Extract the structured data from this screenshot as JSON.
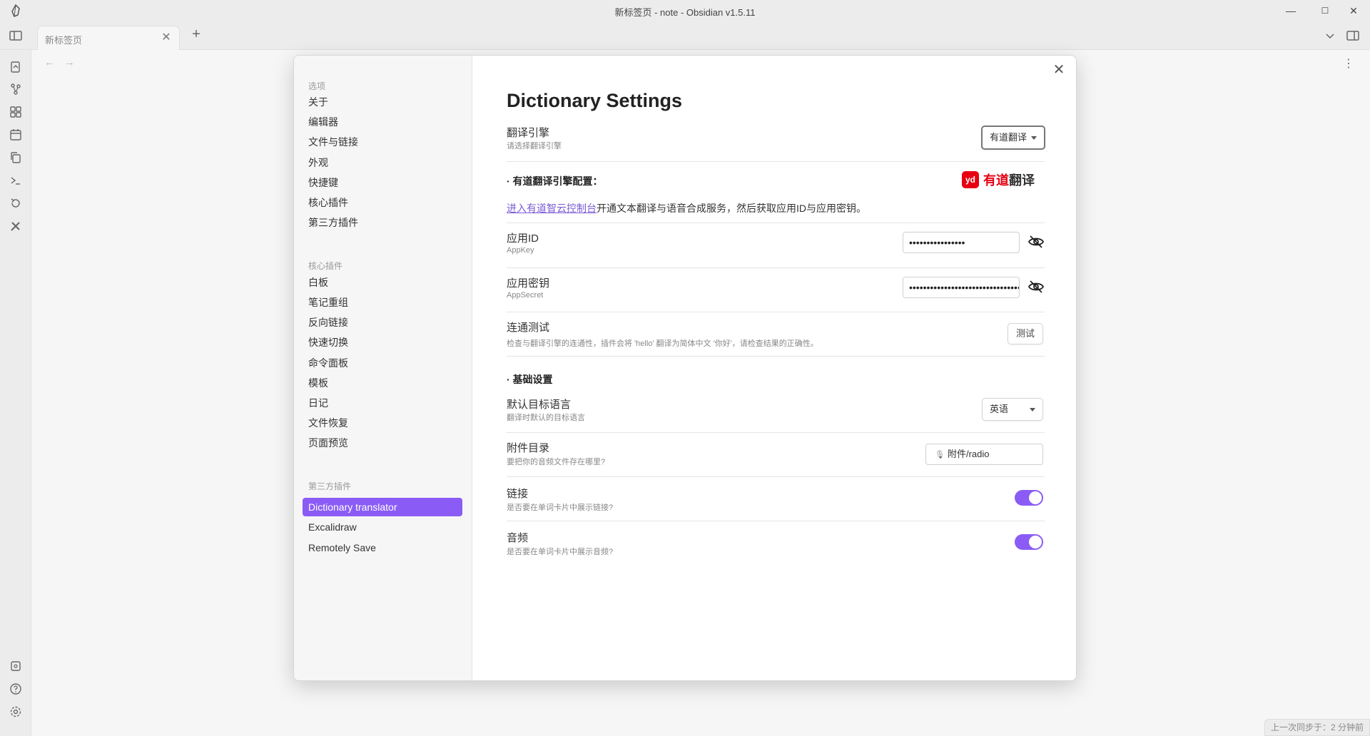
{
  "window": {
    "title": "新标签页 - note - Obsidian v1.5.11",
    "minimize": "—",
    "maximize": "☐",
    "close": "✕"
  },
  "tabs": {
    "active_tab": "新标签页",
    "close": "✕",
    "add": "+"
  },
  "nav": {
    "back": "←",
    "forward": "→",
    "more": "⋮"
  },
  "settings_sidebar": {
    "group_options": "选项",
    "options": [
      "关于",
      "编辑器",
      "文件与链接",
      "外观",
      "快捷键",
      "核心插件",
      "第三方插件"
    ],
    "group_core": "核心插件",
    "core": [
      "白板",
      "笔记重组",
      "反向链接",
      "快速切换",
      "命令面板",
      "模板",
      "日记",
      "文件恢复",
      "页面预览"
    ],
    "group_third": "第三方插件",
    "third": [
      "Dictionary translator",
      "Excalidraw",
      "Remotely Save"
    ]
  },
  "modal": {
    "close": "✕",
    "heading": "Dictionary Settings",
    "engine": {
      "name": "翻译引擎",
      "desc": "请选择翻译引擎",
      "value": "有道翻译"
    },
    "youdao_section": "· 有道翻译引擎配置：",
    "youdao_logo": {
      "mark": "yd",
      "text_red": "有道",
      "text_dark": "翻译"
    },
    "console_link": "进入有道智云控制台",
    "console_rest": "开通文本翻译与语音合成服务，然后获取应用ID与应用密钥。",
    "app_id": {
      "name": "应用ID",
      "desc": "AppKey",
      "value": "••••••••••••••••"
    },
    "app_secret": {
      "name": "应用密钥",
      "desc": "AppSecret",
      "value": "••••••••••••••••••••••••••••••••"
    },
    "test": {
      "name": "连通测试",
      "desc": "检查与翻译引擎的连通性，插件会将 'hello' 翻译为简体中文 '你好'，请检查结果的正确性。",
      "button": "测试"
    },
    "basic_section": "· 基础设置",
    "target_lang": {
      "name": "默认目标语言",
      "desc": "翻译时默认的目标语言",
      "value": "英语"
    },
    "attach_dir": {
      "name": "附件目录",
      "desc": "要把你的音频文件存在哪里?",
      "value": "附件/radio"
    },
    "link": {
      "name": "链接",
      "desc": "是否要在单词卡片中展示链接?",
      "enabled": true
    },
    "audio": {
      "name": "音频",
      "desc": "是否要在单词卡片中展示音频?",
      "enabled": true
    }
  },
  "status": {
    "sync": "上一次同步于：2 分钟前"
  },
  "colors": {
    "accent": "#8a5cf5",
    "link": "#7b5bd6",
    "youdao_red": "#e60012"
  }
}
